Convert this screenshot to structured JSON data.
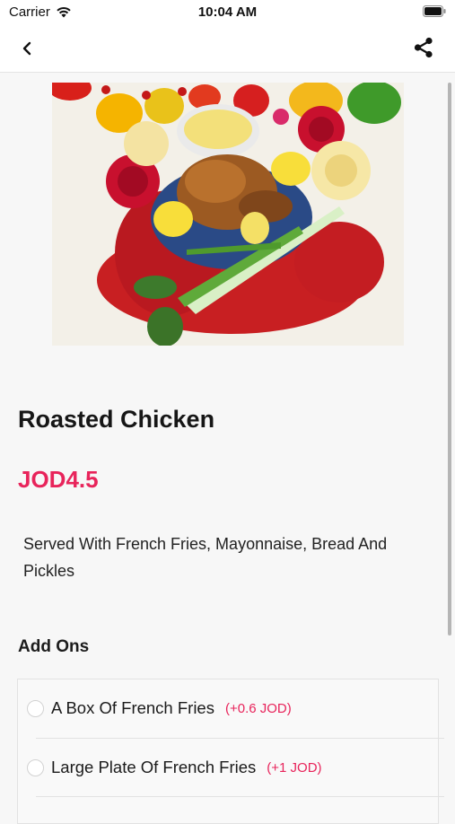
{
  "status_bar": {
    "carrier": "Carrier",
    "time": "10:04 AM"
  },
  "nav": {
    "back_icon": "chevron-left-icon",
    "share_icon": "share-icon"
  },
  "product": {
    "name": "Roasted Chicken",
    "price": "JOD4.5",
    "description": "Served With French Fries, Mayonnaise, Bread And Pickles"
  },
  "addons": {
    "title": "Add Ons",
    "items": [
      {
        "name": "A Box Of French Fries",
        "price": "(+0.6 JOD)"
      },
      {
        "name": "Large Plate Of French Fries",
        "price": "(+1 JOD)"
      }
    ]
  },
  "colors": {
    "accent": "#e8245b",
    "background": "#f7f7f7"
  }
}
